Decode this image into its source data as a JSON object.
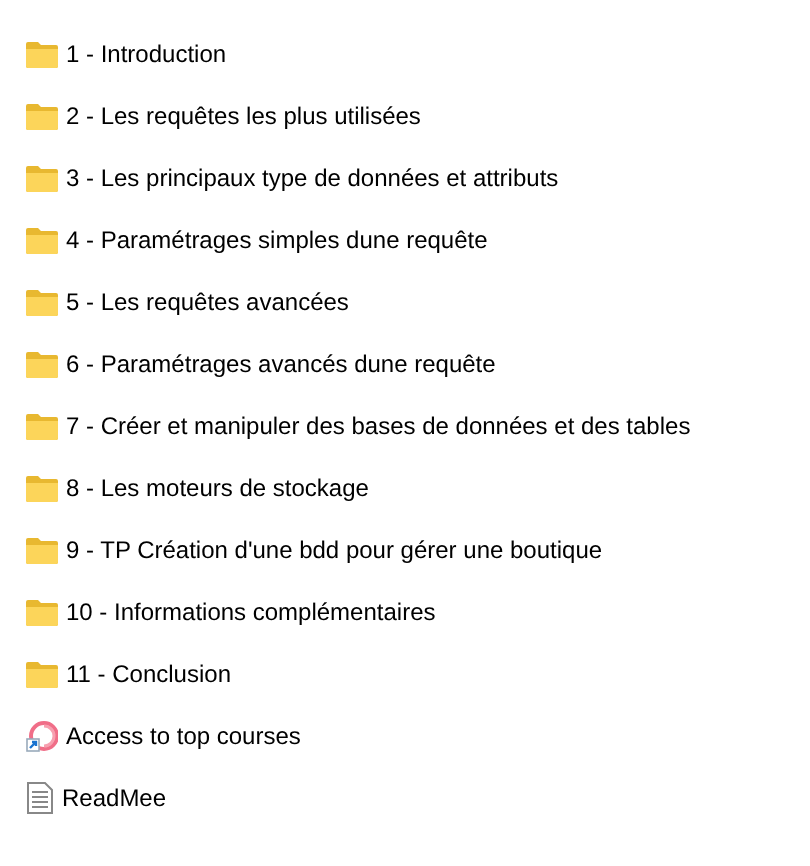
{
  "items": [
    {
      "kind": "folder",
      "name": "1 - Introduction"
    },
    {
      "kind": "folder",
      "name": "2 - Les requêtes les plus utilisées"
    },
    {
      "kind": "folder",
      "name": "3 - Les principaux type de données et attributs"
    },
    {
      "kind": "folder",
      "name": "4 - Paramétrages simples dune requête"
    },
    {
      "kind": "folder",
      "name": "5 - Les requêtes avancées"
    },
    {
      "kind": "folder",
      "name": "6 - Paramétrages avancés dune requête"
    },
    {
      "kind": "folder",
      "name": "7 - Créer et manipuler des bases de données et des tables"
    },
    {
      "kind": "folder",
      "name": "8 - Les moteurs de stockage"
    },
    {
      "kind": "folder",
      "name": "9 - TP Création d'une bdd pour gérer une boutique"
    },
    {
      "kind": "folder",
      "name": "10 - Informations complémentaires"
    },
    {
      "kind": "folder",
      "name": "11 - Conclusion"
    },
    {
      "kind": "shortcut",
      "name": "Access to top courses"
    },
    {
      "kind": "document",
      "name": "ReadMee"
    }
  ]
}
